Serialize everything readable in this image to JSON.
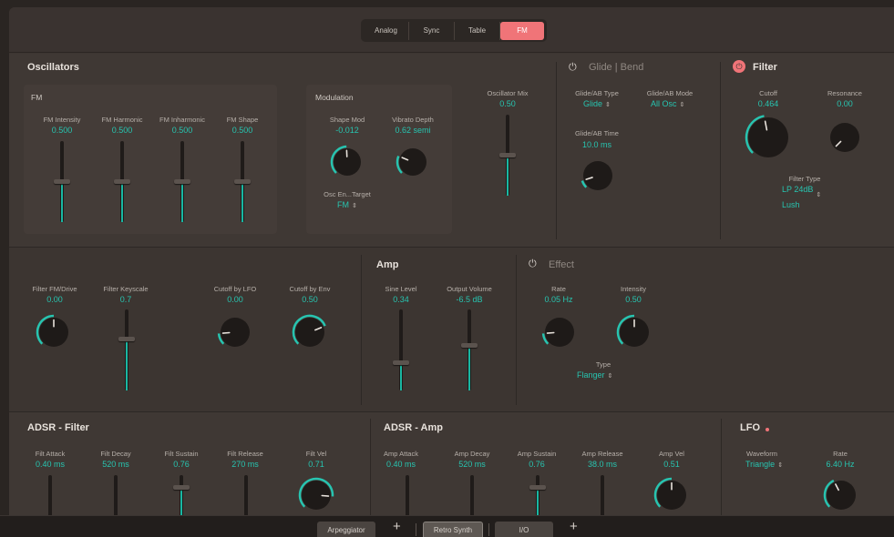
{
  "modes": {
    "items": [
      "Analog",
      "Sync",
      "Table",
      "FM"
    ],
    "active": "FM"
  },
  "oscillators": {
    "title": "Oscillators",
    "fm": {
      "label": "FM",
      "controls": [
        {
          "label": "FM Intensity",
          "value": "0.500",
          "level": 0.5
        },
        {
          "label": "FM Harmonic",
          "value": "0.500",
          "level": 0.5
        },
        {
          "label": "FM Inharmonic",
          "value": "0.500",
          "level": 0.5
        },
        {
          "label": "FM Shape",
          "value": "0.500",
          "level": 0.5
        }
      ]
    },
    "modulation": {
      "label": "Modulation",
      "shape_mod": {
        "label": "Shape Mod",
        "value": "-0.012",
        "level": 0.49
      },
      "vibrato": {
        "label": "Vibrato Depth",
        "value": "0.62 semi",
        "level": 0.25
      },
      "target": {
        "label": "Osc En...Target",
        "value": "FM"
      }
    },
    "mix": {
      "label": "Oscillator Mix",
      "value": "0.50",
      "level": 0.5
    }
  },
  "glide": {
    "title": "Glide | Bend",
    "type": {
      "label": "Glide/AB Type",
      "value": "Glide"
    },
    "mode": {
      "label": "Glide/AB Mode",
      "value": "All Osc"
    },
    "time": {
      "label": "Glide/AB Time",
      "value": "10.0 ms",
      "level": 0.1
    }
  },
  "filter": {
    "title": "Filter",
    "cutoff": {
      "label": "Cutoff",
      "value": "0.464",
      "level": 0.46
    },
    "resonance": {
      "label": "Resonance",
      "value": "0.00",
      "level": 0.0
    },
    "type": {
      "label": "Filter Type",
      "value1": "LP 24dB",
      "value2": "Lush"
    }
  },
  "filter_mod": {
    "drive": {
      "label": "Filter FM/Drive",
      "value": "0.00",
      "level": 0.5
    },
    "keyscale": {
      "label": "Filter Keyscale",
      "value": "0.7",
      "level": 0.35
    },
    "lfo": {
      "label": "Cutoff by LFO",
      "value": "0.00",
      "level": 0.15
    },
    "env": {
      "label": "Cutoff by Env",
      "value": "0.50",
      "level": 0.75
    }
  },
  "amp": {
    "title": "Amp",
    "sine": {
      "label": "Sine Level",
      "value": "0.34",
      "level": 0.34
    },
    "output": {
      "label": "Output Volume",
      "value": "-6.5 dB",
      "level": 0.6
    }
  },
  "effect": {
    "title": "Effect",
    "rate": {
      "label": "Rate",
      "value": "0.05 Hz",
      "level": 0.15
    },
    "intensity": {
      "label": "Intensity",
      "value": "0.50",
      "level": 0.5
    },
    "type": {
      "label": "Type",
      "value": "Flanger"
    }
  },
  "adsr_filter": {
    "title": "ADSR - Filter",
    "attack": {
      "label": "Filt Attack",
      "value": "0.40 ms"
    },
    "decay": {
      "label": "Filt Decay",
      "value": "520 ms"
    },
    "sustain": {
      "label": "Filt Sustain",
      "value": "0.76"
    },
    "release": {
      "label": "Filt Release",
      "value": "270 ms"
    },
    "vel": {
      "label": "Filt Vel",
      "value": "0.71",
      "level": 0.85
    }
  },
  "adsr_amp": {
    "title": "ADSR - Amp",
    "attack": {
      "label": "Amp Attack",
      "value": "0.40 ms"
    },
    "decay": {
      "label": "Amp Decay",
      "value": "520 ms"
    },
    "sustain": {
      "label": "Amp Sustain",
      "value": "0.76"
    },
    "release": {
      "label": "Amp Release",
      "value": "38.0 ms"
    },
    "vel": {
      "label": "Amp Vel",
      "value": "0.51",
      "level": 0.5
    }
  },
  "lfo": {
    "title": "LFO",
    "waveform": {
      "label": "Waveform",
      "value": "Triangle"
    },
    "rate": {
      "label": "Rate",
      "value": "6.40 Hz",
      "level": 0.4
    }
  },
  "bottom": {
    "tab1": "Arpeggiator",
    "tab2": "Retro Synth",
    "tab3": "I/O",
    "plus": "+"
  },
  "icons": {
    "power": "power-icon",
    "updown": "up-down-chevron-icon"
  },
  "colors": {
    "accent": "#27c4b0",
    "active_mode": "#f07478",
    "panel": "#3f3834"
  }
}
